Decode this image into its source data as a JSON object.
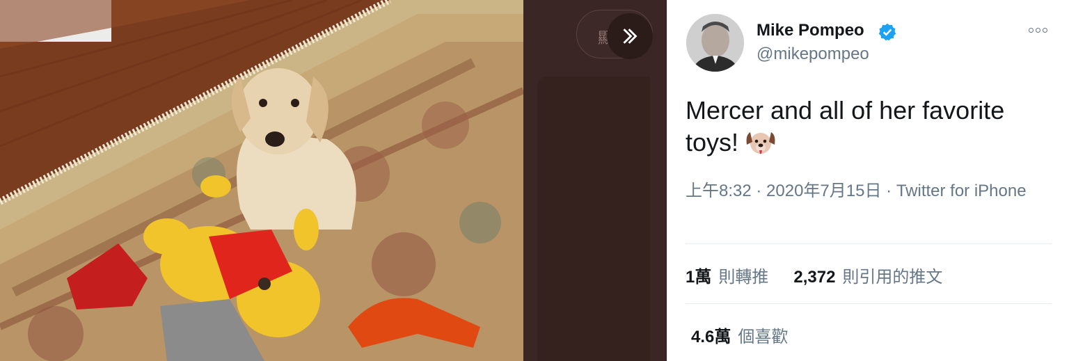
{
  "media": {
    "pill_text": "顯"
  },
  "tweet": {
    "author_name": "Mike Pompeo",
    "handle": "@mikepompeo",
    "text": "Mercer and all of her favorite toys!",
    "emoji": "dog-face-emoji",
    "time": "上午8:32",
    "separator": " · ",
    "date": "2020年7月15日",
    "source": "Twitter for iPhone",
    "stats": [
      {
        "value": "1萬",
        "label": "則轉推"
      },
      {
        "value": "2,372",
        "label": "則引用的推文"
      }
    ],
    "likes": {
      "value": "4.6萬",
      "label": "個喜歡"
    }
  },
  "colors": {
    "verified": "#1da1f2",
    "text_primary": "#14171a",
    "text_secondary": "#657786",
    "divider": "#e6ecf0",
    "viewer_backdrop": "#3f2a28"
  }
}
